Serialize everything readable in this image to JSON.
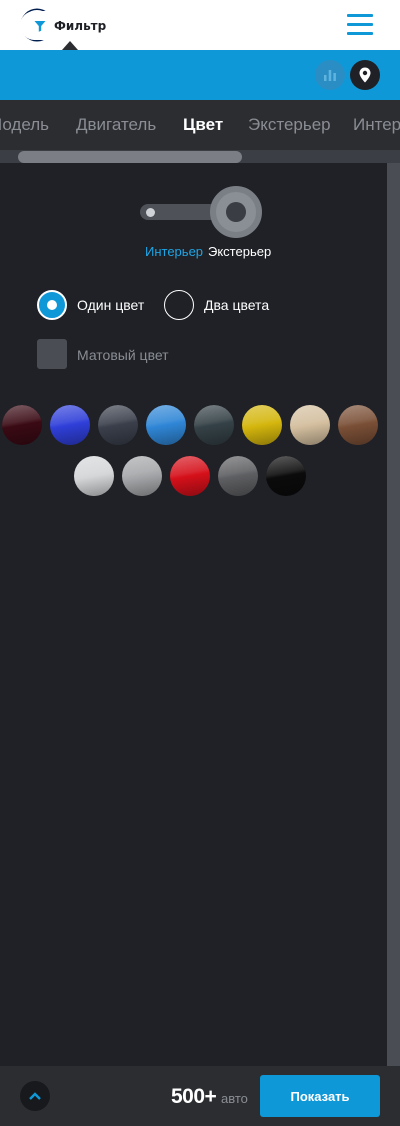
{
  "header": {
    "logo_icon": "vw-logo-icon",
    "menu_icon": "hamburger-menu-icon"
  },
  "filterbar": {
    "filter_label": "Фильтр",
    "filter_icon": "funnel-icon",
    "stats_icon": "bar-chart-icon",
    "location_icon": "map-pin-icon"
  },
  "tabs": [
    {
      "label": "Модель",
      "active": false
    },
    {
      "label": "Двигатель",
      "active": false
    },
    {
      "label": "Цвет",
      "active": true
    },
    {
      "label": "Экстерьер",
      "active": false
    },
    {
      "label": "Интерьер",
      "active": false
    }
  ],
  "color_panel": {
    "toggle_left_label": "Интерьер",
    "toggle_right_label": "Экстерьер",
    "radio_one_label": "Один цвет",
    "radio_two_label": "Два цвета",
    "radio_selected": "Один цвет",
    "matte_label": "Матовый цвет",
    "matte_checked": false,
    "swatches_row1": [
      {
        "name": "dark-cherry",
        "color": "#3a0a14"
      },
      {
        "name": "blue",
        "color": "#2f3fd9"
      },
      {
        "name": "dark-gray-blue",
        "color": "#3a3f4b"
      },
      {
        "name": "light-blue",
        "color": "#2f86d6"
      },
      {
        "name": "dark-teal",
        "color": "#344146"
      },
      {
        "name": "yellow",
        "color": "#d4b60d"
      },
      {
        "name": "beige",
        "color": "#d4bf9f"
      },
      {
        "name": "brown",
        "color": "#7a4f36"
      }
    ],
    "swatches_row2": [
      {
        "name": "white-silver",
        "color": "#d5d6d8"
      },
      {
        "name": "silver",
        "color": "#a6a7aa"
      },
      {
        "name": "red",
        "color": "#d5101a"
      },
      {
        "name": "graphite",
        "color": "#5e5f62"
      },
      {
        "name": "black",
        "color": "#0b0b0c"
      }
    ]
  },
  "bottombar": {
    "up_icon": "chevron-up-icon",
    "count": "500+",
    "count_unit": "авто",
    "show_label": "Показать"
  },
  "colors": {
    "accent": "#0f98d8",
    "dark": "#1f2126",
    "bar": "#2b2d31"
  }
}
